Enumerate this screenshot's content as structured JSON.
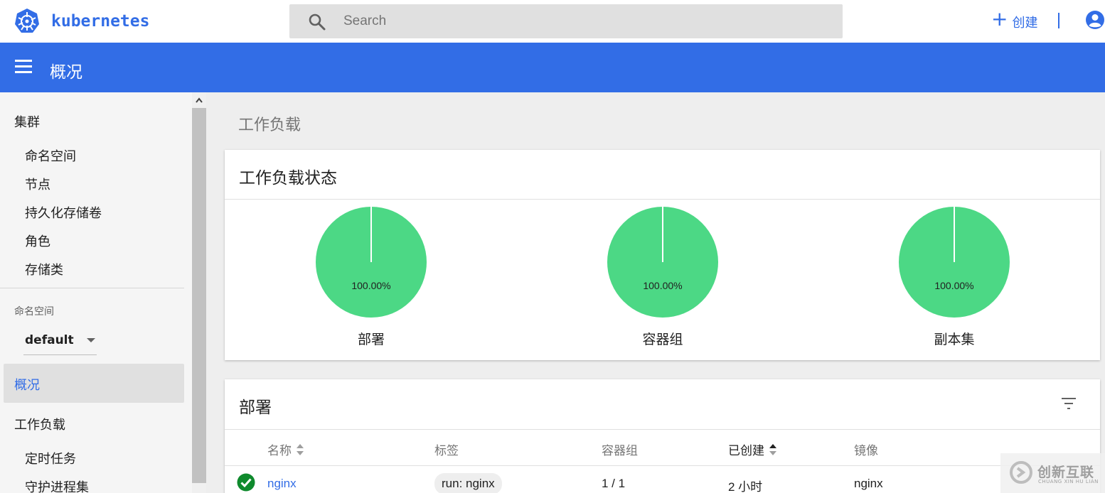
{
  "app": {
    "brand": "kubernetes",
    "search_placeholder": "Search",
    "create_label": "创建",
    "create_plus": "+",
    "accent": "#326de6"
  },
  "header": {
    "title": "概况"
  },
  "sidebar": {
    "cluster_heading": "集群",
    "cluster_items": [
      "命名空间",
      "节点",
      "持久化存储卷",
      "角色",
      "存储类"
    ],
    "namespace_label": "命名空间",
    "namespace_value": "default",
    "active_item": "概况",
    "workloads_heading": "工作负载",
    "workload_items": [
      "定时任务",
      "守护进程集"
    ]
  },
  "main": {
    "section_title": "工作负载",
    "status_card": {
      "title": "工作负载状态",
      "pies": [
        {
          "label": "部署",
          "percent_text": "100.00%",
          "running_fraction": 1.0,
          "color": "#4cd885"
        },
        {
          "label": "容器组",
          "percent_text": "100.00%",
          "running_fraction": 1.0,
          "color": "#4cd885"
        },
        {
          "label": "副本集",
          "percent_text": "100.00%",
          "running_fraction": 1.0,
          "color": "#4cd885"
        }
      ]
    },
    "deployments_card": {
      "title": "部署",
      "columns": [
        "名称",
        "标签",
        "容器组",
        "已创建",
        "镜像"
      ],
      "rows": [
        {
          "status_icon": "check-circle-icon",
          "name": "nginx",
          "label": "run: nginx",
          "pods": "1 / 1",
          "created": "2 小时",
          "image": "nginx"
        }
      ]
    }
  },
  "watermark": {
    "text": "创新互联",
    "sub": "CHUANG XIN HU LIAN"
  }
}
